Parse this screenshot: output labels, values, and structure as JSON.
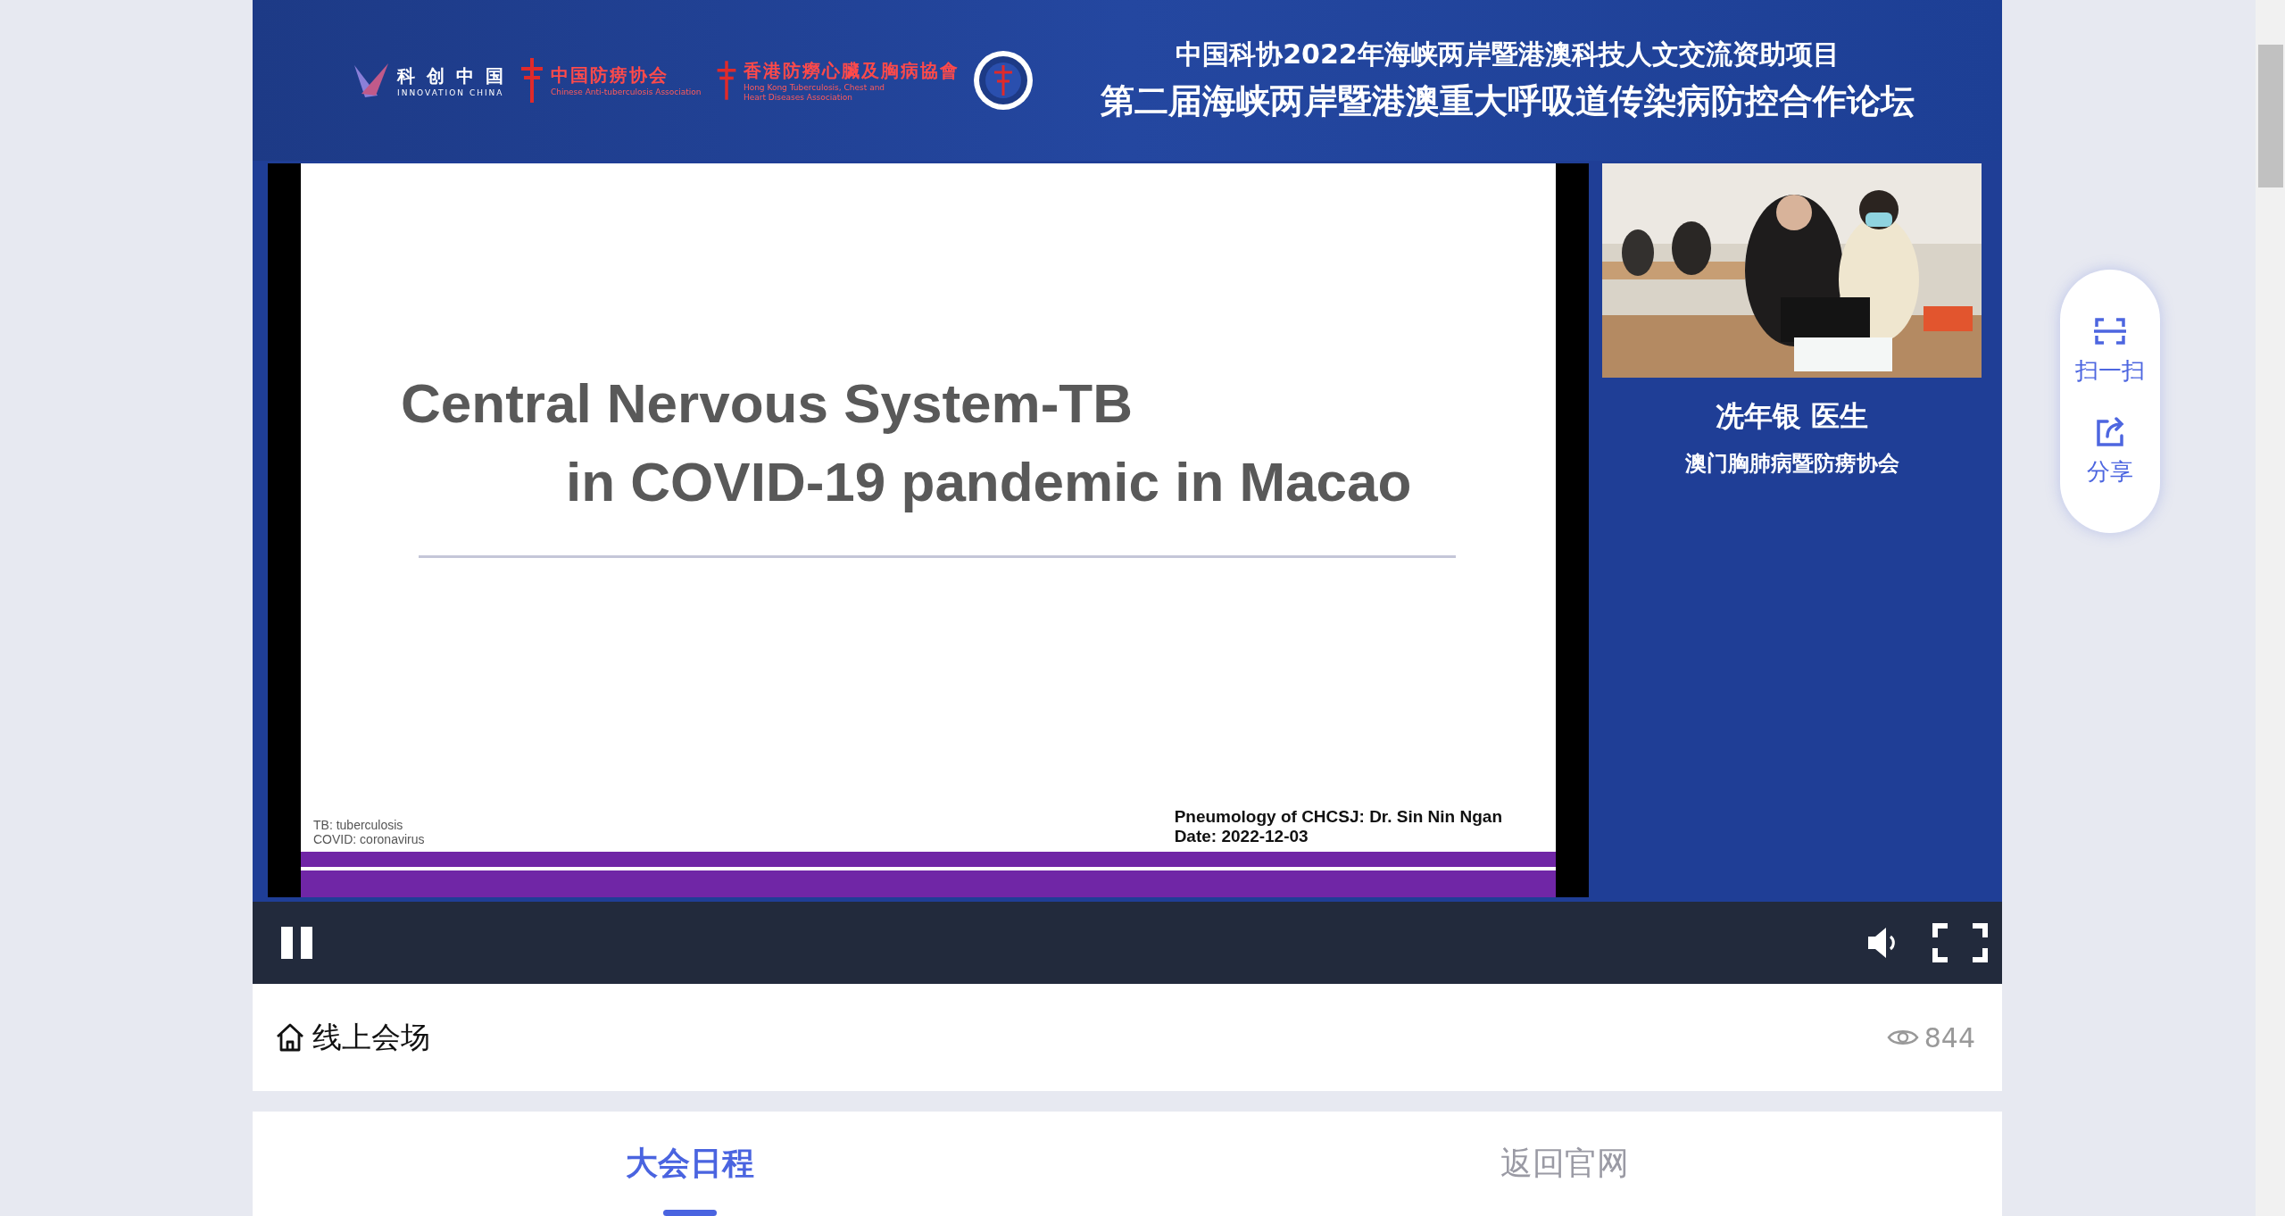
{
  "header": {
    "logos": [
      {
        "kind": "innovation",
        "title": "科 创 中 国",
        "subtitle": "INNOVATION CHINA"
      },
      {
        "kind": "cross",
        "title": "中国防痨协会",
        "subtitle": "Chinese Anti-tuberculosis Association"
      },
      {
        "kind": "cross-small",
        "title": "香港防癆心臟及胸病協會",
        "subtitle": "Hong Kong Tuberculosis, Chest and Heart Diseases Association"
      },
      {
        "kind": "seal"
      }
    ],
    "title": "中国科协2022年海峡两岸暨港澳科技人文交流资助项目",
    "subtitle": "第二届海峡两岸暨港澳重大呼吸道传染病防控合作论坛"
  },
  "slide": {
    "title_lines": [
      "Central Nervous System-TB",
      "in COVID-19 pandemic in Macao"
    ],
    "notes": [
      "TB: tuberculosis",
      "COVID: coronavirus"
    ],
    "credits": [
      "Pneumology of CHCSJ: Dr. Sin Nin Ngan",
      "Date: 2022-12-03"
    ]
  },
  "speaker": {
    "name": "冼年银 医生",
    "organization": "澳门胸肺病暨防痨协会"
  },
  "player": {
    "playing": true
  },
  "venue": {
    "label": "线上会场",
    "views": "844"
  },
  "tabs": [
    {
      "label": "大会日程",
      "selected": true
    },
    {
      "label": "返回官网",
      "selected": false
    }
  ],
  "float_menu": [
    {
      "kind": "scan",
      "label": "扫一扫"
    },
    {
      "kind": "share",
      "label": "分享"
    }
  ]
}
